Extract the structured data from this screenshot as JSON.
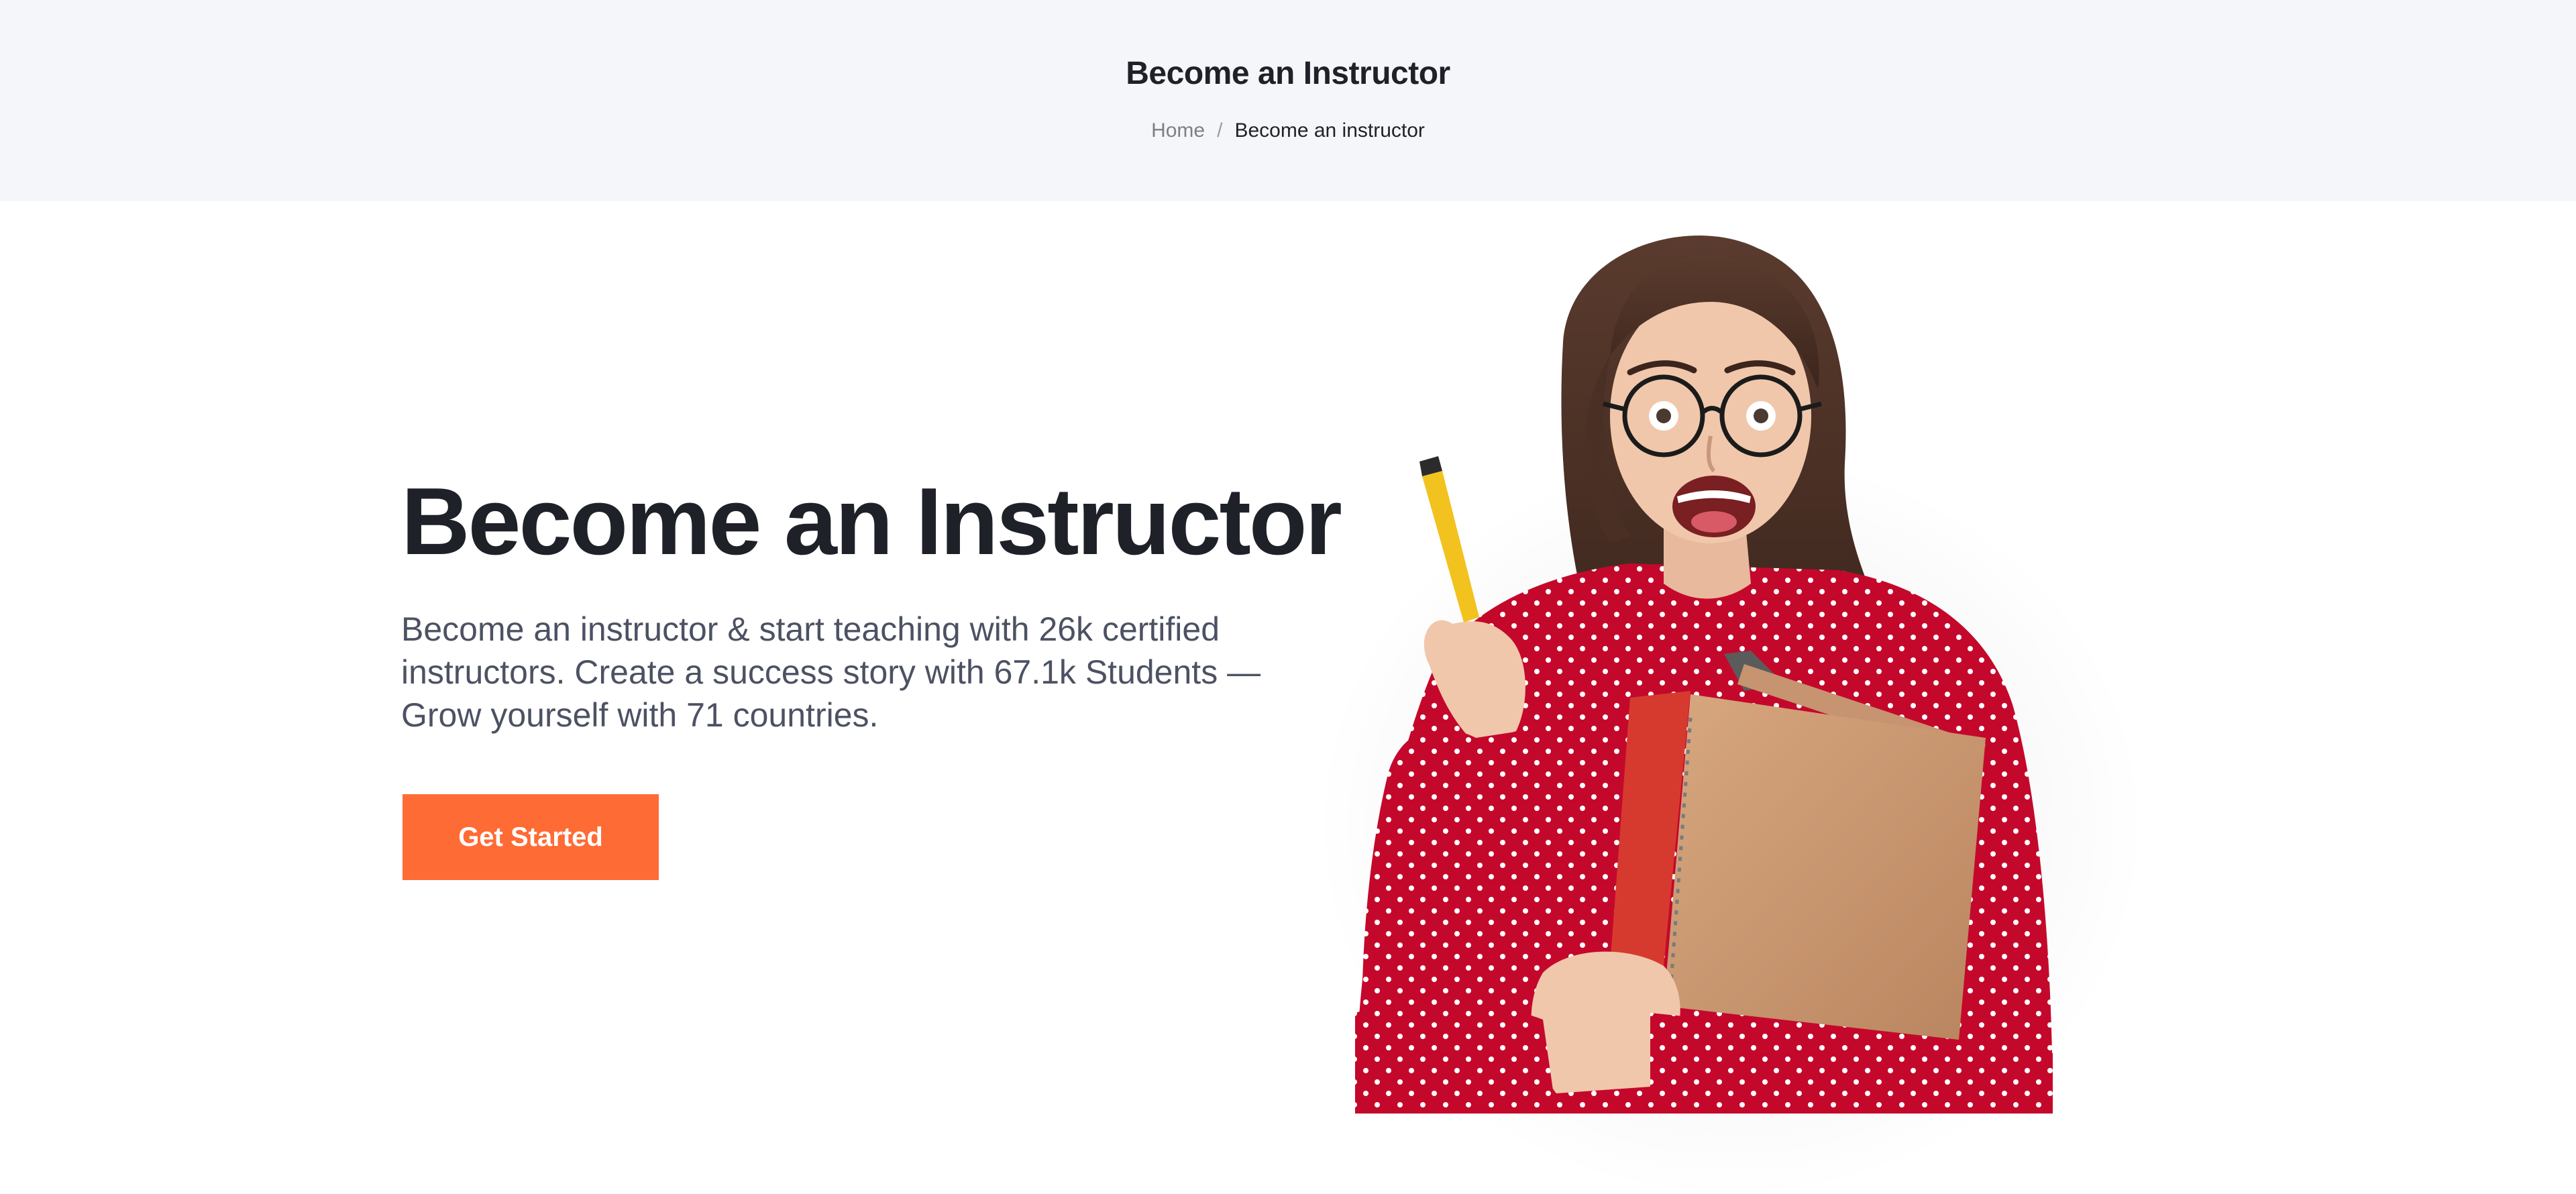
{
  "header": {
    "title": "Become an Instructor",
    "breadcrumb": {
      "home": "Home",
      "separator": "/",
      "current": "Become an instructor"
    }
  },
  "hero": {
    "title": "Become an Instructor",
    "description": "Become an instructor & start teaching with 26k certified instructors. Create a success story with 67.1k Students — Grow yourself with 71 countries.",
    "cta_label": "Get Started",
    "image_subject": "excited student with glasses holding notebooks and a pencil"
  },
  "colors": {
    "accent": "#ff6b35",
    "header_bg": "#f5f6f9",
    "heading": "#1f2129",
    "body_text": "#4c5263",
    "shirt": "#c4082b"
  }
}
